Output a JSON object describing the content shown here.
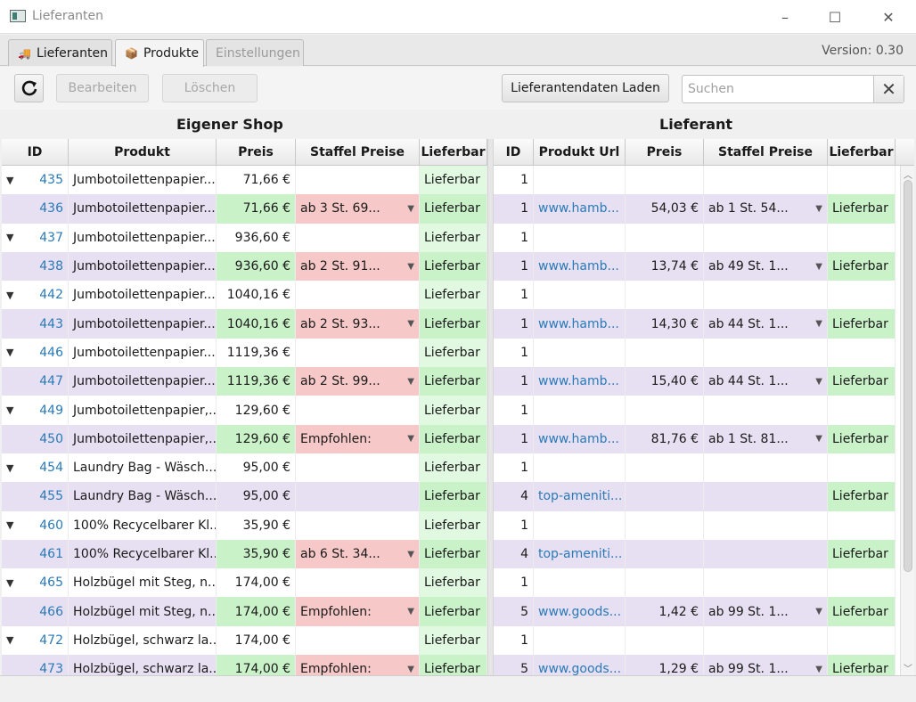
{
  "window": {
    "title": "Lieferanten",
    "minimize": "–",
    "maximize": "☐",
    "close": "✕"
  },
  "tabs": [
    {
      "label": "Lieferanten",
      "icon": "truck-icon"
    },
    {
      "label": "Produkte",
      "icon": "package-icon"
    },
    {
      "label": "Einstellungen",
      "icon": ""
    }
  ],
  "version": "Version: 0.30",
  "toolbar": {
    "refresh_icon": "refresh-icon",
    "edit_label": "Bearbeiten",
    "delete_label": "Löschen",
    "load_label": "Lieferantendaten Laden",
    "search_placeholder": "Suchen",
    "search_clear": "✕"
  },
  "left_title": "Eigener Shop",
  "right_title": "Lieferant",
  "left_columns": [
    "ID",
    "Produkt",
    "Preis",
    "Staffel Preise",
    "Lieferbar"
  ],
  "right_columns": [
    "ID",
    "Produkt Url",
    "Preis",
    "Staffel Preise",
    "Lieferbar"
  ],
  "rows": [
    {
      "type": "parent",
      "id": "435",
      "product": "Jumbotoilettenpapier...",
      "price": "71,66 €",
      "staffel": "",
      "lieferbar": "Lieferbar",
      "s_id": "1",
      "s_url": "",
      "s_price": "",
      "s_staffel": "",
      "s_lieferbar": ""
    },
    {
      "type": "child",
      "id": "436",
      "product": "Jumbotoilettenpapier...",
      "price": "71,66 €",
      "staffel": "ab 3 St. 69...",
      "lieferbar": "Lieferbar",
      "s_id": "1",
      "s_url": "www.hamb...",
      "s_price": "54,03 €",
      "s_staffel": "ab 1 St. 54...",
      "s_lieferbar": "Lieferbar"
    },
    {
      "type": "parent",
      "id": "437",
      "product": "Jumbotoilettenpapier...",
      "price": "936,60 €",
      "staffel": "",
      "lieferbar": "Lieferbar",
      "s_id": "1",
      "s_url": "",
      "s_price": "",
      "s_staffel": "",
      "s_lieferbar": ""
    },
    {
      "type": "child",
      "id": "438",
      "product": "Jumbotoilettenpapier...",
      "price": "936,60 €",
      "staffel": "ab 2 St. 91...",
      "lieferbar": "Lieferbar",
      "s_id": "1",
      "s_url": "www.hamb...",
      "s_price": "13,74 €",
      "s_staffel": "ab 49 St. 1...",
      "s_lieferbar": "Lieferbar"
    },
    {
      "type": "parent",
      "id": "442",
      "product": "Jumbotoilettenpapier...",
      "price": "1040,16 €",
      "staffel": "",
      "lieferbar": "Lieferbar",
      "s_id": "1",
      "s_url": "",
      "s_price": "",
      "s_staffel": "",
      "s_lieferbar": ""
    },
    {
      "type": "child",
      "id": "443",
      "product": "Jumbotoilettenpapier...",
      "price": "1040,16 €",
      "staffel": "ab 2 St. 93...",
      "lieferbar": "Lieferbar",
      "s_id": "1",
      "s_url": "www.hamb...",
      "s_price": "14,30 €",
      "s_staffel": "ab 44 St. 1...",
      "s_lieferbar": "Lieferbar"
    },
    {
      "type": "parent",
      "id": "446",
      "product": "Jumbotoilettenpapier...",
      "price": "1119,36 €",
      "staffel": "",
      "lieferbar": "Lieferbar",
      "s_id": "1",
      "s_url": "",
      "s_price": "",
      "s_staffel": "",
      "s_lieferbar": ""
    },
    {
      "type": "child",
      "id": "447",
      "product": "Jumbotoilettenpapier...",
      "price": "1119,36 €",
      "staffel": "ab 2 St. 99...",
      "lieferbar": "Lieferbar",
      "s_id": "1",
      "s_url": "www.hamb...",
      "s_price": "15,40 €",
      "s_staffel": "ab 44 St. 1...",
      "s_lieferbar": "Lieferbar"
    },
    {
      "type": "parent",
      "id": "449",
      "product": "Jumbotoilettenpapier,...",
      "price": "129,60 €",
      "staffel": "",
      "lieferbar": "Lieferbar",
      "s_id": "1",
      "s_url": "",
      "s_price": "",
      "s_staffel": "",
      "s_lieferbar": ""
    },
    {
      "type": "child",
      "id": "450",
      "product": "Jumbotoilettenpapier,...",
      "price": "129,60 €",
      "staffel": "Empfohlen:",
      "lieferbar": "Lieferbar",
      "s_id": "1",
      "s_url": "www.hamb...",
      "s_price": "81,76 €",
      "s_staffel": "ab 1 St. 81...",
      "s_lieferbar": "Lieferbar"
    },
    {
      "type": "parent",
      "id": "454",
      "product": "Laundry Bag - Wäsch...",
      "price": "95,00 €",
      "staffel": "",
      "lieferbar": "Lieferbar",
      "s_id": "1",
      "s_url": "",
      "s_price": "",
      "s_staffel": "",
      "s_lieferbar": ""
    },
    {
      "type": "child",
      "id": "455",
      "product": "Laundry Bag - Wäsch...",
      "price": "95,00 €",
      "staffel": "",
      "lieferbar": "Lieferbar",
      "s_id": "4",
      "s_url": "top-ameniti...",
      "s_price": "",
      "s_staffel": "",
      "s_lieferbar": "Lieferbar"
    },
    {
      "type": "parent",
      "id": "460",
      "product": "100% Recycelbarer Kl...",
      "price": "35,90 €",
      "staffel": "",
      "lieferbar": "Lieferbar",
      "s_id": "1",
      "s_url": "",
      "s_price": "",
      "s_staffel": "",
      "s_lieferbar": ""
    },
    {
      "type": "child",
      "id": "461",
      "product": "100% Recycelbarer Kl...",
      "price": "35,90 €",
      "staffel": "ab 6 St. 34...",
      "lieferbar": "Lieferbar",
      "s_id": "4",
      "s_url": "top-ameniti...",
      "s_price": "",
      "s_staffel": "",
      "s_lieferbar": "Lieferbar"
    },
    {
      "type": "parent",
      "id": "465",
      "product": "Holzbügel mit Steg, n...",
      "price": "174,00 €",
      "staffel": "",
      "lieferbar": "Lieferbar",
      "s_id": "1",
      "s_url": "",
      "s_price": "",
      "s_staffel": "",
      "s_lieferbar": ""
    },
    {
      "type": "child",
      "id": "466",
      "product": "Holzbügel mit Steg, n...",
      "price": "174,00 €",
      "staffel": "Empfohlen:",
      "lieferbar": "Lieferbar",
      "s_id": "5",
      "s_url": "www.goods...",
      "s_price": "1,42 €",
      "s_staffel": "ab 99 St. 1...",
      "s_lieferbar": "Lieferbar"
    },
    {
      "type": "parent",
      "id": "472",
      "product": "Holzbügel, schwarz la...",
      "price": "174,00 €",
      "staffel": "",
      "lieferbar": "Lieferbar",
      "s_id": "1",
      "s_url": "",
      "s_price": "",
      "s_staffel": "",
      "s_lieferbar": ""
    },
    {
      "type": "child",
      "id": "473",
      "product": "Holzbügel, schwarz la...",
      "price": "174,00 €",
      "staffel": "Empfohlen:",
      "lieferbar": "Lieferbar",
      "s_id": "5",
      "s_url": "www.goods...",
      "s_price": "1,29 €",
      "s_staffel": "ab 99 St. 1...",
      "s_lieferbar": "Lieferbar"
    }
  ]
}
